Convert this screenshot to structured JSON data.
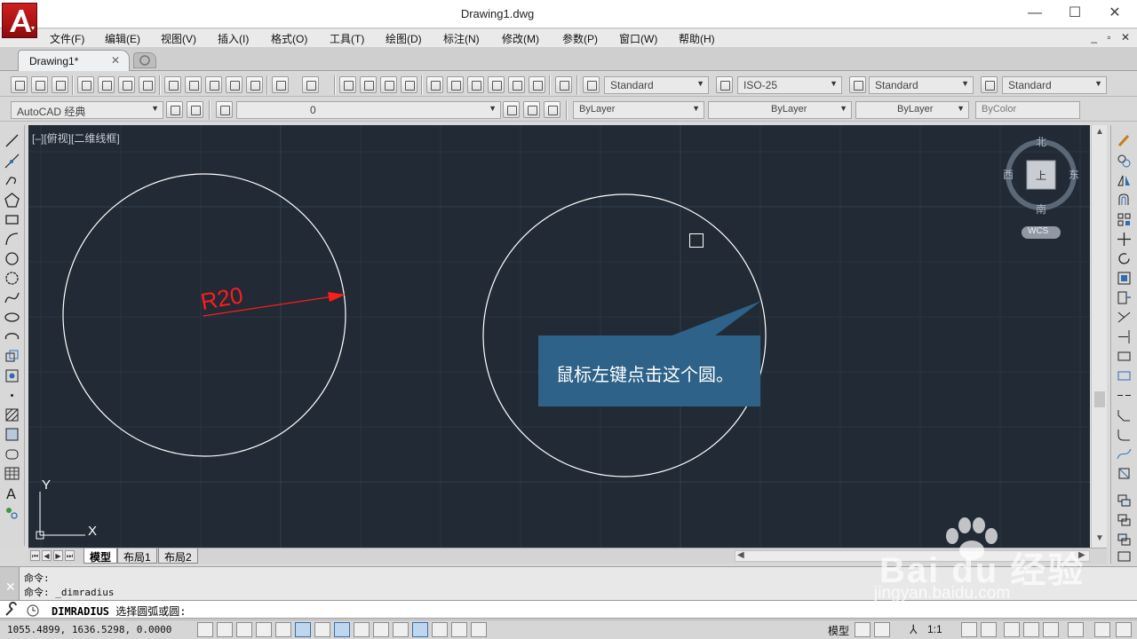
{
  "window": {
    "title": "Drawing1.dwg",
    "minimize": "—",
    "maximize": "☐",
    "close": "✕"
  },
  "menu": {
    "items": [
      "文件(F)",
      "编辑(E)",
      "视图(V)",
      "插入(I)",
      "格式(O)",
      "工具(T)",
      "绘图(D)",
      "标注(N)",
      "修改(M)",
      "参数(P)",
      "窗口(W)",
      "帮助(H)"
    ],
    "mdi_controls": "_ ▫ ✕"
  },
  "tabs": {
    "document": "Drawing1*",
    "close": "✕"
  },
  "toolbar": {
    "text_style": "Standard",
    "dim_style": "ISO-25",
    "table_style": "Standard",
    "multileader_style": "Standard",
    "workspace": "AutoCAD 经典",
    "layer": "0",
    "color": "ByLayer",
    "linetype": "ByLayer",
    "lineweight": "ByLayer",
    "plot_style": "ByColor"
  },
  "canvas": {
    "viewport_label": "[–][俯视][二维线框]",
    "background": "#212a35",
    "dimension_text": "R20",
    "dimension_color": "#ff1c1c",
    "callout_text": "鼠标左键点击这个圆。",
    "callout_color": "#2e6289",
    "ucs_x": "X",
    "ucs_y": "Y"
  },
  "viewcube": {
    "north": "北",
    "south": "南",
    "east": "东",
    "west": "西",
    "face": "上",
    "wcs": "WCS"
  },
  "layout_tabs": [
    "模型",
    "布局1",
    "布局2"
  ],
  "command": {
    "history": [
      "命令:",
      "命令: _dimradius"
    ],
    "prompt_command": "DIMRADIUS",
    "prompt_text": "选择圆弧或圆:"
  },
  "status": {
    "coords": "1055.4899, 1636.5298, 0.0000",
    "model": "模型",
    "scale": "1:1"
  },
  "watermark": {
    "brand": "Bai du 经验",
    "url": "jingyan.baidu.com"
  }
}
